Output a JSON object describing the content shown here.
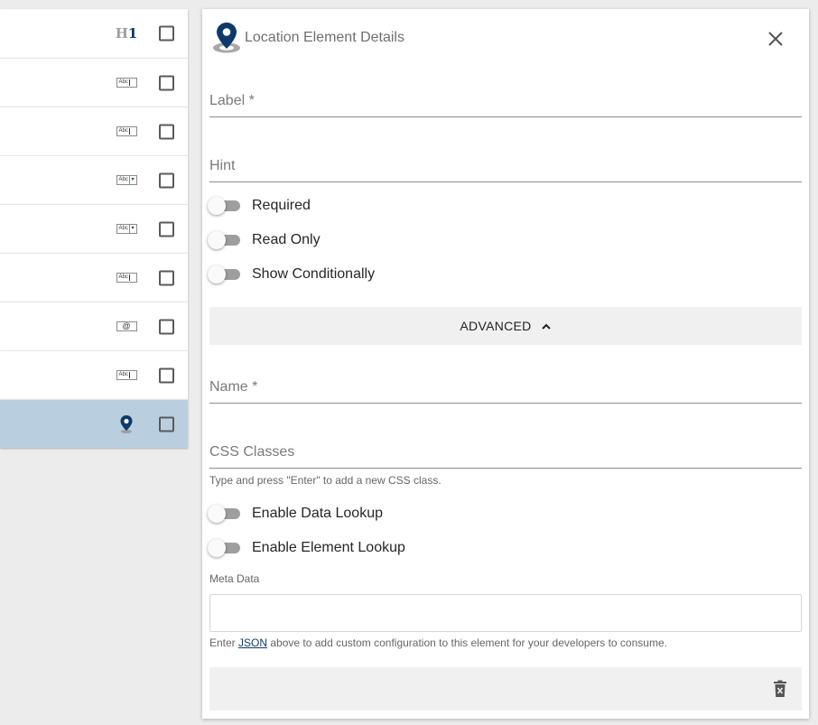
{
  "element_list": {
    "rows": [
      {
        "icon": "heading-h1-icon",
        "h_text": "H",
        "one_text": "1",
        "checked": false,
        "selected": false
      },
      {
        "icon": "text-input-icon",
        "abc_text": "Abc",
        "checked": false,
        "selected": false
      },
      {
        "icon": "text-input-icon",
        "abc_text": "Abc",
        "checked": false,
        "selected": false
      },
      {
        "icon": "dropdown-input-icon",
        "abc_text": "Abc",
        "dd_text": "▾",
        "checked": false,
        "selected": false
      },
      {
        "icon": "dropdown-input-icon",
        "abc_text": "Abc",
        "dd_text": "▾",
        "checked": false,
        "selected": false
      },
      {
        "icon": "text-input-icon",
        "abc_text": "Abc",
        "checked": false,
        "selected": false
      },
      {
        "icon": "email-input-icon",
        "email_text": "@",
        "checked": false,
        "selected": false
      },
      {
        "icon": "text-input-icon",
        "abc_text": "Abc",
        "checked": false,
        "selected": false
      },
      {
        "icon": "location-pin-icon",
        "checked": false,
        "selected": true
      }
    ]
  },
  "panel": {
    "title": "Location Element Details",
    "fields": {
      "label": {
        "label": "Label *",
        "value": ""
      },
      "hint": {
        "label": "Hint",
        "value": ""
      },
      "name": {
        "label": "Name *",
        "value": ""
      },
      "css_classes": {
        "label": "CSS Classes",
        "value": "",
        "helper": "Type and press \"Enter\" to add a new CSS class."
      }
    },
    "toggles": {
      "required": {
        "label": "Required",
        "on": false
      },
      "read_only": {
        "label": "Read Only",
        "on": false
      },
      "show_conditionally": {
        "label": "Show Conditionally",
        "on": false
      },
      "enable_data_lookup": {
        "label": "Enable Data Lookup",
        "on": false
      },
      "enable_element_lookup": {
        "label": "Enable Element Lookup",
        "on": false
      }
    },
    "advanced": {
      "label": "ADVANCED",
      "expanded": true
    },
    "meta_data": {
      "label": "Meta Data",
      "value": "",
      "helper_before": "Enter ",
      "helper_link": "JSON",
      "helper_after": " above to add custom configuration to this element for your developers to consume."
    }
  },
  "colors": {
    "brand_navy": "#0d3a6b",
    "selected_row": "#b9cfdf",
    "toggle_track": "#9e9e9e",
    "bar_gray": "#f0f0f0",
    "page_bg": "#ececec"
  }
}
